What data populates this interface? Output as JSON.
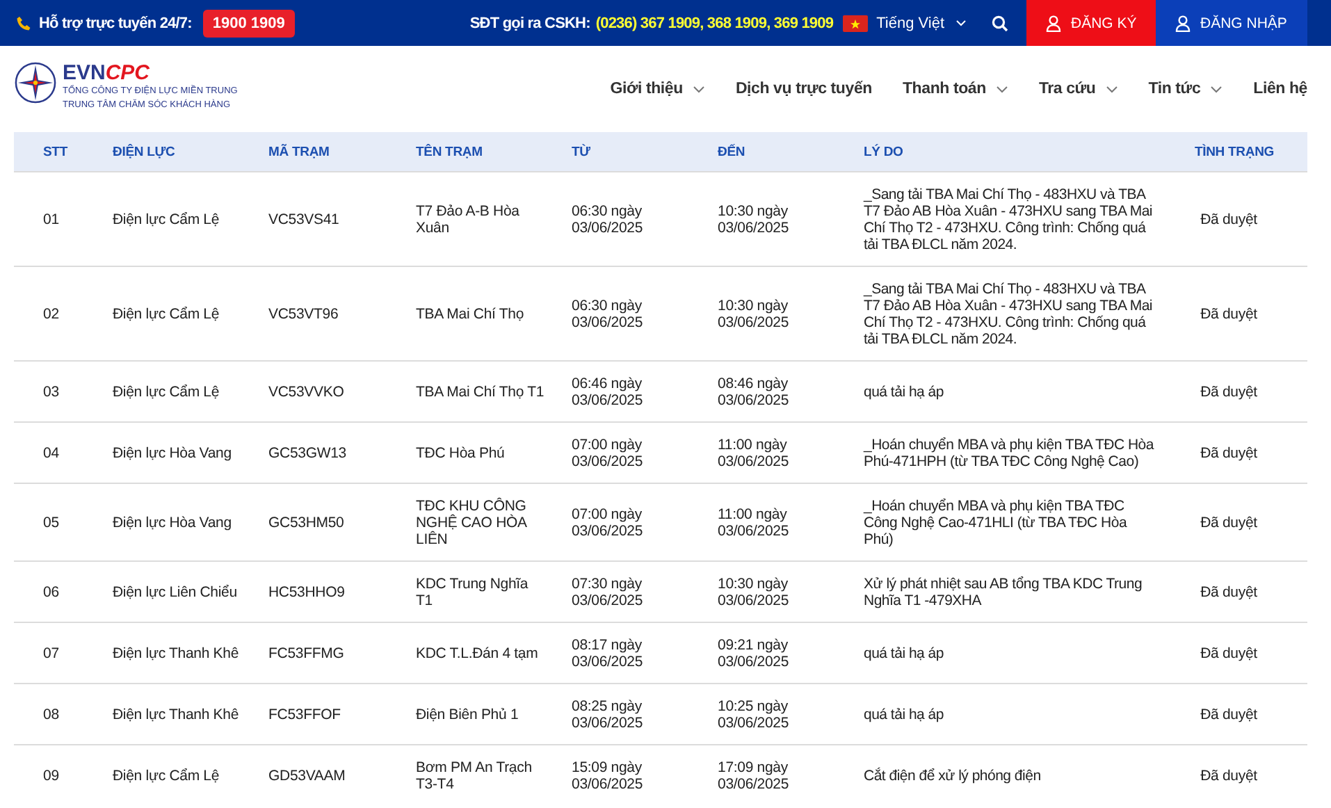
{
  "top_bar": {
    "hotline_label": "Hỗ trợ trực tuyến 24/7:",
    "hotline_number": "1900 1909",
    "cskh_label": "SĐT gọi ra CSKH:",
    "cskh_numbers": "(0236) 367 1909, 368 1909, 369 1909",
    "language": "Tiếng Việt",
    "register": "ĐĂNG KÝ",
    "login": "ĐĂNG NHẬP"
  },
  "logo": {
    "brand_main": "EVN",
    "brand_accent": "CPC",
    "line_1": "TỔNG CÔNG TY ĐIỆN LỰC MIỀN TRUNG",
    "line_2": "TRUNG TÂM CHĂM SÓC KHÁCH HÀNG"
  },
  "nav": [
    {
      "label": "Giới thiệu",
      "has_dropdown": true
    },
    {
      "label": "Dịch vụ trực tuyến",
      "has_dropdown": false
    },
    {
      "label": "Thanh toán",
      "has_dropdown": true
    },
    {
      "label": "Tra cứu",
      "has_dropdown": true
    },
    {
      "label": "Tin tức",
      "has_dropdown": true
    },
    {
      "label": "Liên hệ",
      "has_dropdown": false
    }
  ],
  "table": {
    "columns": [
      "STT",
      "ĐIỆN LỰC",
      "MÃ TRẠM",
      "TÊN TRẠM",
      "TỪ",
      "ĐẾN",
      "LÝ DO",
      "TÌNH TRẠNG"
    ],
    "rows": [
      {
        "stt": "01",
        "dien_luc": "Điện lực Cẩm Lệ",
        "ma_tram": "VC53VS41",
        "ten_tram": "T7 Đảo A-B Hòa Xuân",
        "tu": "06:30 ngày 03/06/2025",
        "den": "10:30 ngày 03/06/2025",
        "ly_do": "_Sang tải TBA Mai Chí Thọ - 483HXU và TBA T7 Đảo AB Hòa Xuân - 473HXU sang TBA Mai Chí Thọ T2 - 473HXU. Công trình: Chống quá tải TBA ĐLCL năm 2024.",
        "tinh_trang": "Đã duyệt"
      },
      {
        "stt": "02",
        "dien_luc": "Điện lực Cẩm Lệ",
        "ma_tram": "VC53VT96",
        "ten_tram": "TBA Mai Chí Thọ",
        "tu": "06:30 ngày 03/06/2025",
        "den": "10:30 ngày 03/06/2025",
        "ly_do": "_Sang tải TBA Mai Chí Thọ - 483HXU và TBA T7 Đảo AB Hòa Xuân - 473HXU sang TBA Mai Chí Thọ T2 - 473HXU. Công trình: Chống quá tải TBA ĐLCL năm 2024.",
        "tinh_trang": "Đã duyệt"
      },
      {
        "stt": "03",
        "dien_luc": "Điện lực Cẩm Lệ",
        "ma_tram": "VC53VVKO",
        "ten_tram": "TBA Mai Chí Thọ T1",
        "tu": "06:46 ngày 03/06/2025",
        "den": "08:46 ngày 03/06/2025",
        "ly_do": "quá tải hạ áp",
        "tinh_trang": "Đã duyệt"
      },
      {
        "stt": "04",
        "dien_luc": "Điện lực Hòa Vang",
        "ma_tram": "GC53GW13",
        "ten_tram": "TĐC Hòa Phú",
        "tu": "07:00 ngày 03/06/2025",
        "den": "11:00 ngày 03/06/2025",
        "ly_do": "_Hoán chuyển MBA và phụ kiện TBA TĐC Hòa Phú-471HPH (từ TBA TĐC Công Nghệ Cao)",
        "tinh_trang": "Đã duyệt"
      },
      {
        "stt": "05",
        "dien_luc": "Điện lực Hòa Vang",
        "ma_tram": "GC53HM50",
        "ten_tram": "TĐC KHU CÔNG NGHỆ CAO HÒA LIÊN",
        "tu": "07:00 ngày 03/06/2025",
        "den": "11:00 ngày 03/06/2025",
        "ly_do": "_Hoán chuyển MBA và phụ kiện TBA TĐC Công Nghệ Cao-471HLI (từ TBA TĐC Hòa Phú)",
        "tinh_trang": "Đã duyệt"
      },
      {
        "stt": "06",
        "dien_luc": "Điện lực Liên Chiểu",
        "ma_tram": "HC53HHO9",
        "ten_tram": "KDC Trung Nghĩa T1",
        "tu": "07:30 ngày 03/06/2025",
        "den": "10:30 ngày 03/06/2025",
        "ly_do": "Xử lý phát nhiệt sau AB tổng TBA KDC Trung Nghĩa T1 -479XHA",
        "tinh_trang": "Đã duyệt"
      },
      {
        "stt": "07",
        "dien_luc": "Điện lực Thanh Khê",
        "ma_tram": "FC53FFMG",
        "ten_tram": "KDC T.L.Đán 4 tạm",
        "tu": "08:17 ngày 03/06/2025",
        "den": "09:21 ngày 03/06/2025",
        "ly_do": "quá tải hạ áp",
        "tinh_trang": "Đã duyệt"
      },
      {
        "stt": "08",
        "dien_luc": "Điện lực Thanh Khê",
        "ma_tram": "FC53FFOF",
        "ten_tram": "Điện Biên Phủ 1",
        "tu": "08:25 ngày 03/06/2025",
        "den": "10:25 ngày 03/06/2025",
        "ly_do": "quá tải hạ áp",
        "tinh_trang": "Đã duyệt"
      },
      {
        "stt": "09",
        "dien_luc": "Điện lực Cẩm Lệ",
        "ma_tram": "GD53VAAM",
        "ten_tram": "Bơm PM An Trạch T3-T4",
        "tu": "15:09 ngày 03/06/2025",
        "den": "17:09 ngày 03/06/2025",
        "ly_do": "Cắt điện để xử lý phóng điện",
        "tinh_trang": "Đã duyệt"
      }
    ]
  }
}
